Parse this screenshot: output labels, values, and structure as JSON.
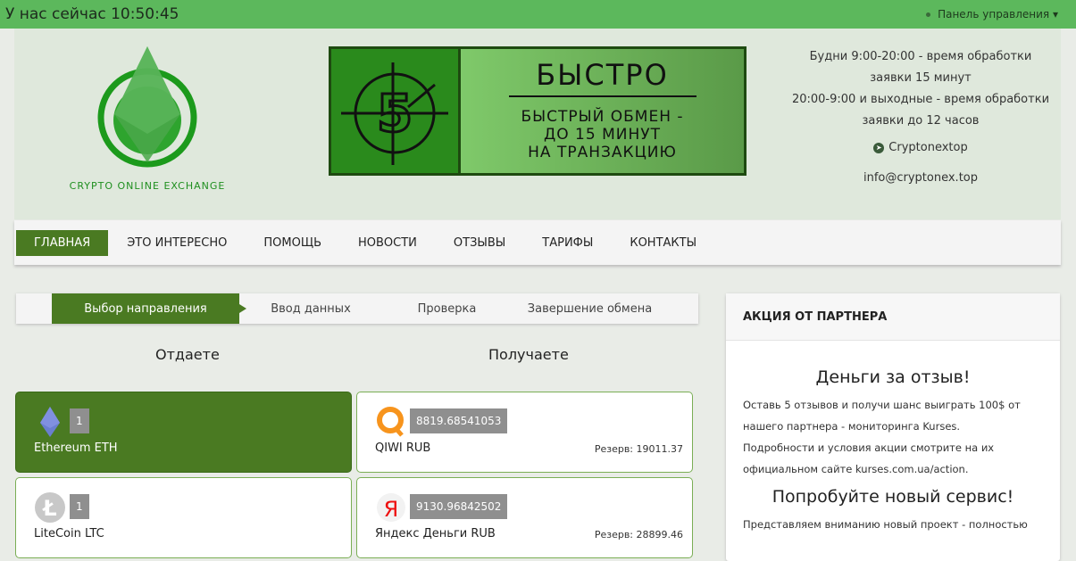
{
  "topbar": {
    "time_text": "У нас сейчас 10:50:45",
    "panel_label": "Панель управления"
  },
  "logo": {
    "text": "CRYPTO ONLINE EXCHANGE"
  },
  "banner": {
    "title": "БЫСТРО",
    "line1": "БЫСТРЫЙ ОБМЕН -",
    "line2": "ДО 15 МИНУТ",
    "line3": "НА ТРАНЗАКЦИЮ"
  },
  "info": {
    "line1": "Будни 9:00-20:00 - время обработки заявки 15 минут",
    "line2": "20:00-9:00 и выходные - время обработки заявки до 12 часов",
    "telegram": "Cryptonextop",
    "email": "info@cryptonex.top"
  },
  "nav": [
    "ГЛАВНАЯ",
    "ЭТО ИНТЕРЕСНО",
    "ПОМОЩЬ",
    "НОВОСТИ",
    "ОТЗЫВЫ",
    "ТАРИФЫ",
    "КОНТАКТЫ"
  ],
  "steps": [
    "Выбор направления",
    "Ввод данных",
    "Проверка",
    "Завершение обмена"
  ],
  "give": {
    "title": "Отдаете",
    "items": [
      {
        "name": "Ethereum ETH",
        "rate": "1"
      },
      {
        "name": "LiteCoin LTC",
        "rate": "1"
      }
    ]
  },
  "get": {
    "title": "Получаете",
    "items": [
      {
        "name": "QIWI RUB",
        "rate": "8819.68541053",
        "reserve": "Резерв: 19011.37"
      },
      {
        "name": "Яндекс Деньги RUB",
        "rate": "9130.96842502",
        "reserve": "Резерв: 28899.46"
      }
    ]
  },
  "side": {
    "header": "АКЦИЯ ОТ ПАРТНЕРА",
    "h1": "Деньги за отзыв!",
    "p1": "Оставь 5 отзывов и получи шанс выиграть 100$ от нашего партнера - мониторинга Kurses.",
    "p2": "Подробности и условия акции смотрите на их официальном сайте kurses.com.ua/action.",
    "h2": "Попробуйте новый сервис!",
    "p3": "Представляем вниманию новый проект - полностью"
  }
}
